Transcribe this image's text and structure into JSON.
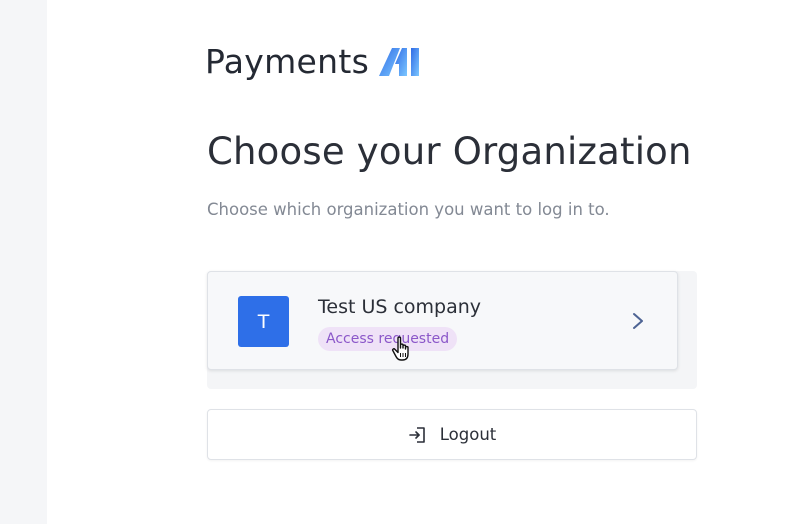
{
  "brand": {
    "name": "Payments",
    "logo_text": "AI",
    "colors": {
      "logo_start": "#3b7bea",
      "logo_end": "#79c3ff"
    }
  },
  "page": {
    "title": "Choose your Organization",
    "subtitle": "Choose which organization you want to log in to."
  },
  "organizations": [
    {
      "initial": "T",
      "name": "Test US company",
      "status": "Access requested",
      "icon": "chevron-right-icon",
      "colors": {
        "avatar": "#2e6fe8",
        "badge_bg": "#efe2f7",
        "badge_text": "#8b57c9"
      }
    }
  ],
  "logout": {
    "label": "Logout",
    "icon": "logout-icon"
  }
}
